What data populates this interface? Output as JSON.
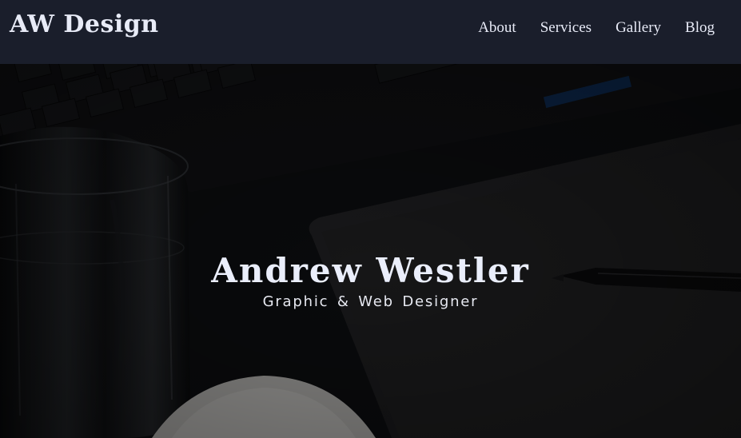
{
  "brand": {
    "name": "AW Design"
  },
  "nav": {
    "items": [
      {
        "label": "About"
      },
      {
        "label": "Services"
      },
      {
        "label": "Gallery"
      },
      {
        "label": "Blog"
      }
    ]
  },
  "hero": {
    "title": "Andrew Westler",
    "subtitle": "Graphic & Web Designer",
    "background": "dark desk photo with keyboard, glass of water, tablet and stylus, coffee cup"
  },
  "colors": {
    "navbar_bg": "#1a1e2b",
    "text": "#e8ebf7"
  }
}
